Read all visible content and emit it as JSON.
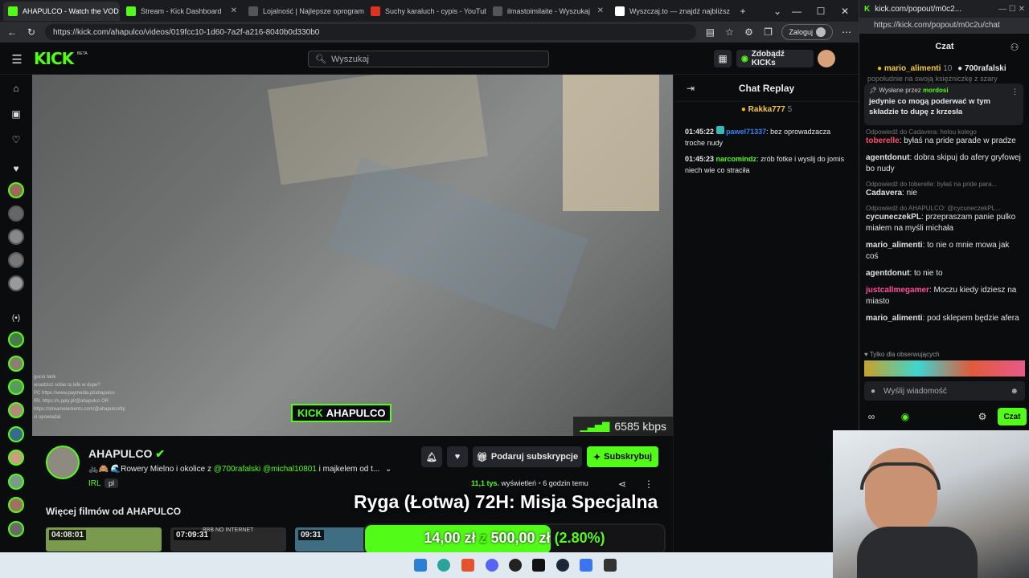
{
  "browser": {
    "tabs": [
      {
        "label": "AHAPULCO - Watch the VOD",
        "color": "#53fc18"
      },
      {
        "label": "Stream - Kick Dashboard",
        "color": "#53fc18"
      },
      {
        "label": "Lojalność | Najlepsze oprogram",
        "color": "#555"
      },
      {
        "label": "Suchy karaluch - cypis - YouTub",
        "color": "#d32"
      },
      {
        "label": "ilmastoimilaite - Wyszukaj",
        "color": "#555"
      },
      {
        "label": "Wyszczaj.to — znajdź najbliższ",
        "color": "#fff"
      }
    ],
    "url": "https://kick.com/ahapulco/videos/019fcc10-1d60-7a2f-a216-8040b0d330b0",
    "login_label": "Zaloguj"
  },
  "header": {
    "logo": "KICK",
    "logo_beta": "BETA",
    "search_placeholder": "Wyszukaj",
    "kicks_label": "Zdobądź KICKs"
  },
  "video": {
    "kbps": "6585 kbps",
    "watermark_kick": "KICK",
    "watermark_name": "AHAPULCO",
    "overlay_chat": [
      "gucio tank",
      "wsadzisz sobie ta lafe w dupe?",
      "PC https://www.paymedia.pl/ahapulco",
      "IRL https://s.pply.pl/@ahapulco OR",
      "https://streamelements.com/@ahapulco/tip",
      "ci opowiadał"
    ]
  },
  "channel": {
    "name": "AHAPULCO",
    "title_prefix": "🚲🙈 🌊Rowery Mielno i okolice z",
    "mention1": "@700rafalski",
    "mention2": "@michal10801",
    "title_suffix": "i majkelem od t...",
    "category": "IRL",
    "lang": "pl",
    "views_num": "11,1 tys.",
    "views_label": "wyświetleń",
    "time_ago": "6 godzin temu",
    "gift_label": "Podaruj subskrypcje",
    "sub_label": "Subskrybuj"
  },
  "more": {
    "title": "Więcej filmów od AHAPULCO",
    "thumbs": [
      {
        "duration": "04:08:01",
        "color": "#7a9a4e"
      },
      {
        "duration": "07:09:31",
        "caption": "BBB NO INTERNET",
        "color": "#2a2a2a"
      },
      {
        "duration": "09:31",
        "color": "#3f6e83"
      }
    ]
  },
  "overlay": {
    "title": "Ryga (Łotwa) 72H: Misja Specjalna",
    "amount1": "14,00 zł",
    "z": "z",
    "amount2": "500,00 zł",
    "percent": "(2.80%)",
    "progress_fraction": 0.028
  },
  "replay": {
    "title": "Chat Replay",
    "pinned_user": "Rakka777",
    "pinned_count": "5",
    "messages": [
      {
        "time": "01:45:22",
        "user": "pawel71337",
        "user_color": "#3b82f6",
        "text": "bez oprowadzacza troche nudy"
      },
      {
        "time": "01:45:23",
        "user": "narcomindz",
        "user_color": "#53fc18",
        "text": "zrób fotke i wyslij do jomis niech wie co straciła"
      }
    ]
  },
  "popout": {
    "url": "kick.com/popout/m0c2...",
    "full_url": "https://kick.com/popout/m0c2u/chat",
    "title": "Czat",
    "top_users": [
      {
        "name": "mario_alimenti",
        "count": "10"
      },
      {
        "name": "700rafalski",
        "count": "1"
      }
    ],
    "pinned_by_label": "Wysłane przez",
    "pinned_by_user": "mordosi",
    "pinned_text": "jedynie co mogą poderwać w tym składzie to dupę z krzesła",
    "cut_text": "popołudnie na swoją księżniczkę z szary",
    "msgs": [
      {
        "reply": "Odpowiedź do Cadavera: helou kolego",
        "user": "toberelle",
        "color": "#ff4d6d",
        "text": "byłaś na pride parade w pradze"
      },
      {
        "user": "agentdonut",
        "color": "#e0e0e0",
        "text": "dobra skipuj do afery gryfowej bo nudy"
      },
      {
        "reply": "Odpowiedź do toberelle: byłaś na pride para...",
        "user": "Cadavera",
        "color": "#e0e0e0",
        "text": "nie"
      },
      {
        "reply": "Odpowiedź do AHAPULCO: @cycuneczekPL...",
        "user": "cycuneczekPL",
        "color": "#e0e0e0",
        "text": "przepraszam panie pulko miałem na myśli michała"
      },
      {
        "user": "mario_alimenti",
        "color": "#e0e0e0",
        "text": "to nie o mnie mowa jak coś"
      },
      {
        "user": "agentdonut",
        "color": "#e0e0e0",
        "text": "to nie to"
      },
      {
        "user": "justcallmegamer",
        "color": "#ff4d9d",
        "text": "Moczu kiedy idziesz na miasto"
      },
      {
        "user": "mario_alimenti",
        "color": "#e0e0e0",
        "text": "pod sklepem będzie afera"
      }
    ],
    "followers_only": "Tylko dla obserwujących",
    "input_placeholder": "Wyślij wiadomość",
    "send_label": "Czat"
  }
}
